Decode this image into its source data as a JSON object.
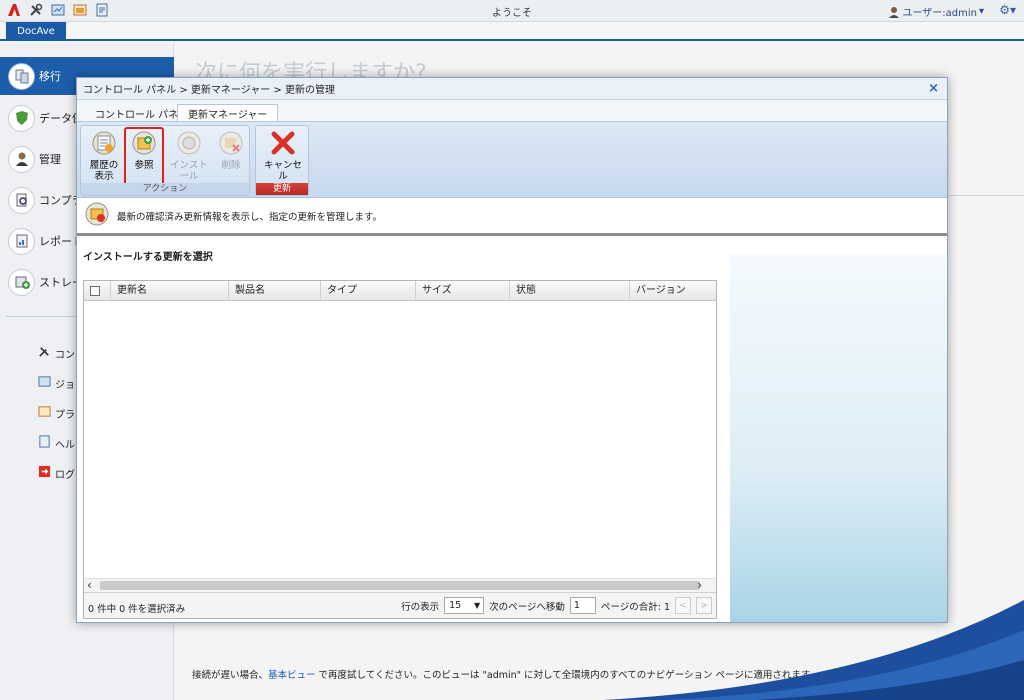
{
  "topbar": {
    "welcome": "ようこそ",
    "user_label": "ユーザー:admin",
    "icons": [
      "docave-logo-icon",
      "tools-icon",
      "job-monitor-icon",
      "plan-manager-icon",
      "help-icon"
    ]
  },
  "app_tab": "DocAve",
  "sidebar": {
    "items": [
      {
        "label": "移行",
        "icon": "migration-icon",
        "active": true
      },
      {
        "label": "データ保",
        "icon": "data-protection-icon",
        "active": false
      },
      {
        "label": "管理",
        "icon": "administration-icon",
        "active": false
      },
      {
        "label": "コンプラ",
        "icon": "compliance-icon",
        "active": false
      },
      {
        "label": "レポート",
        "icon": "report-icon",
        "active": false
      },
      {
        "label": "ストレー",
        "icon": "storage-icon",
        "active": false
      }
    ],
    "subitems": [
      {
        "label": "コント",
        "icon": "control-panel-icon"
      },
      {
        "label": "ジョブ",
        "icon": "job-monitor-icon"
      },
      {
        "label": "プラン",
        "icon": "plan-manager-icon"
      },
      {
        "label": "ヘル",
        "icon": "help-icon"
      },
      {
        "label": "ログア",
        "icon": "logout-icon"
      }
    ]
  },
  "background": {
    "heading": "次に何を実行しますか?",
    "footer_prefix": "接続が遅い場合、",
    "footer_link": "基本ビュー",
    "footer_suffix": " で再度試してください。このビューは \"admin\" に対して全環境内のすべてのナビゲーション ページに適用されます。"
  },
  "dialog": {
    "breadcrumb": "コントロール パネル > 更新マネージャー > 更新の管理",
    "close": "×",
    "tabs": [
      {
        "label": "コントロール パネル",
        "active": false
      },
      {
        "label": "更新マネージャー",
        "active": true
      }
    ],
    "ribbon": {
      "action_group_label": "アクション",
      "update_group_label": "更新",
      "buttons": {
        "history": "履歴の表示",
        "browse": "参照",
        "install": "インストール",
        "delete": "削除",
        "cancel": "キャンセル"
      },
      "history_line1": "履歴の",
      "history_line2": "表示"
    },
    "description": "最新の確認済み更新情報を表示し、指定の更新を管理します。",
    "section_title": "インストールする更新を選択",
    "table": {
      "columns": [
        "更新名",
        "製品名",
        "タイプ",
        "サイズ",
        "状態",
        "バージョン"
      ],
      "rows": []
    },
    "footer": {
      "selection": "0 件中 0 件を選択済み",
      "rows_label": "行の表示",
      "rows_value": "15",
      "goto_label": "次のページへ移動",
      "goto_value": "1",
      "total_label": "ページの合計: 1"
    }
  },
  "colors": {
    "accent": "#1d5eab",
    "highlight_border": "#e2211c",
    "cancel_red": "#d9302a"
  }
}
